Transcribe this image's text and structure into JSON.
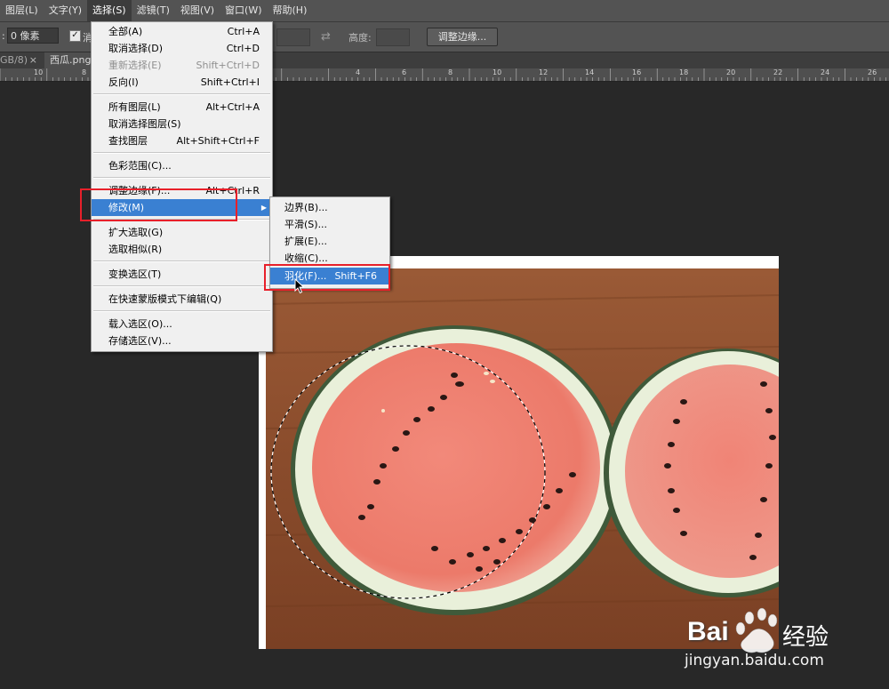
{
  "menubar": {
    "items": [
      "图层(L)",
      "文字(Y)",
      "选择(S)",
      "滤镜(T)",
      "视图(V)",
      "窗口(W)",
      "帮助(H)"
    ],
    "active": "选择(S)"
  },
  "options": {
    "colon": ":",
    "feather_value": "0 像素",
    "check": "✓",
    "anti_alias_partial": "消",
    "height_label": "高度:",
    "refine_edge_button": "调整边缘..."
  },
  "tabs": {
    "tab1_label": "GB/8)",
    "tab1_close": "×",
    "tab2_label": "西瓜.png"
  },
  "ruler": {
    "labels": [
      "10",
      "8",
      "4",
      "6",
      "8",
      "10",
      "12",
      "14",
      "16",
      "18",
      "20",
      "22",
      "24",
      "26"
    ]
  },
  "select_menu": {
    "items": [
      {
        "label": "全部(A)",
        "shortcut": "Ctrl+A",
        "disabled": false
      },
      {
        "label": "取消选择(D)",
        "shortcut": "Ctrl+D",
        "disabled": false
      },
      {
        "label": "重新选择(E)",
        "shortcut": "Shift+Ctrl+D",
        "disabled": true
      },
      {
        "label": "反向(I)",
        "shortcut": "Shift+Ctrl+I",
        "disabled": false
      },
      {
        "label": "所有图层(L)",
        "shortcut": "Alt+Ctrl+A",
        "disabled": false
      },
      {
        "label": "取消选择图层(S)",
        "shortcut": "",
        "disabled": false
      },
      {
        "label": "查找图层",
        "shortcut": "Alt+Shift+Ctrl+F",
        "disabled": false
      },
      {
        "label": "色彩范围(C)...",
        "shortcut": "",
        "disabled": false
      },
      {
        "label": "调整边缘(F)...",
        "shortcut": "Alt+Ctrl+R",
        "disabled": false
      },
      {
        "label": "修改(M)",
        "shortcut": "",
        "disabled": false,
        "submenu": true,
        "highlighted": true
      },
      {
        "label": "扩大选取(G)",
        "shortcut": "",
        "disabled": false
      },
      {
        "label": "选取相似(R)",
        "shortcut": "",
        "disabled": false
      },
      {
        "label": "变换选区(T)",
        "shortcut": "",
        "disabled": false
      },
      {
        "label": "在快速蒙版模式下编辑(Q)",
        "shortcut": "",
        "disabled": false
      },
      {
        "label": "载入选区(O)...",
        "shortcut": "",
        "disabled": false
      },
      {
        "label": "存储选区(V)...",
        "shortcut": "",
        "disabled": false
      }
    ]
  },
  "modify_menu": {
    "items": [
      {
        "label": "边界(B)...",
        "shortcut": ""
      },
      {
        "label": "平滑(S)...",
        "shortcut": ""
      },
      {
        "label": "扩展(E)...",
        "shortcut": ""
      },
      {
        "label": "收缩(C)...",
        "shortcut": ""
      },
      {
        "label": "羽化(F)...",
        "shortcut": "Shift+F6",
        "highlighted": true
      }
    ]
  },
  "watermark": {
    "brand": "Bai",
    "brand_cn": "经验",
    "url": "jingyan.baidu.com"
  },
  "colors": {
    "highlight": "#3a80d2",
    "annotation_red": "#e8202a",
    "menu_bg": "#f0f0f0"
  }
}
